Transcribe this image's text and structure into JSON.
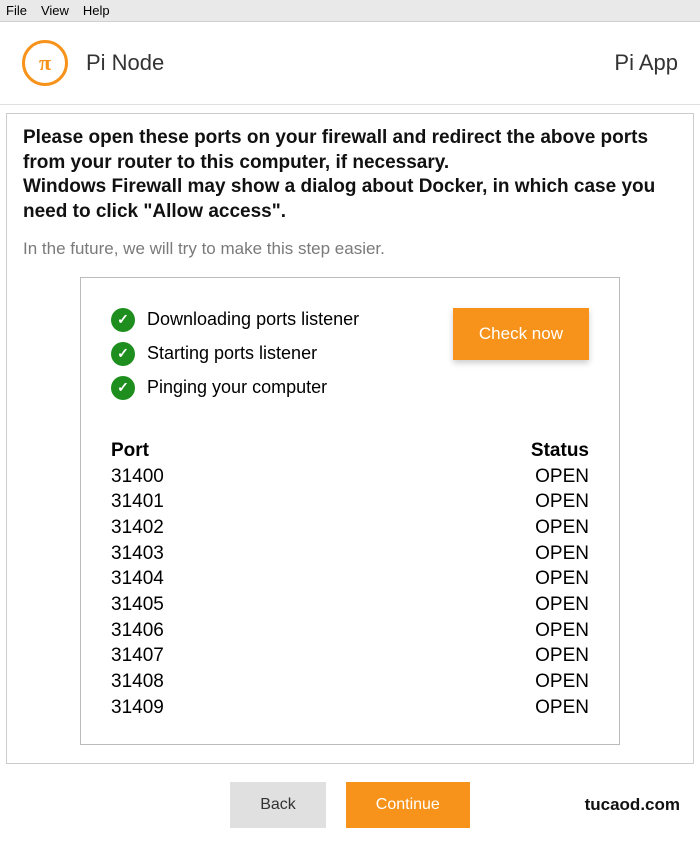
{
  "menu": {
    "file": "File",
    "view": "View",
    "help": "Help"
  },
  "header": {
    "app_name": "Pi Node",
    "app_label": "Pi App",
    "logo_glyph": "π"
  },
  "main": {
    "instruction_line1": "Please open these ports on your firewall and redirect the above ports from your router to this computer, if necessary.",
    "instruction_line2": "Windows Firewall may show a dialog about Docker, in which case you need to click \"Allow access\".",
    "subnote": "In the future, we will try to make this step easier.",
    "checks": [
      {
        "label": "Downloading ports listener"
      },
      {
        "label": "Starting ports listener"
      },
      {
        "label": "Pinging your computer"
      }
    ],
    "check_button": "Check now",
    "port_header": {
      "port": "Port",
      "status": "Status"
    },
    "ports": [
      {
        "port": "31400",
        "status": "OPEN"
      },
      {
        "port": "31401",
        "status": "OPEN"
      },
      {
        "port": "31402",
        "status": "OPEN"
      },
      {
        "port": "31403",
        "status": "OPEN"
      },
      {
        "port": "31404",
        "status": "OPEN"
      },
      {
        "port": "31405",
        "status": "OPEN"
      },
      {
        "port": "31406",
        "status": "OPEN"
      },
      {
        "port": "31407",
        "status": "OPEN"
      },
      {
        "port": "31408",
        "status": "OPEN"
      },
      {
        "port": "31409",
        "status": "OPEN"
      }
    ]
  },
  "footer": {
    "back": "Back",
    "continue": "Continue",
    "watermark": "tucaod.com"
  }
}
